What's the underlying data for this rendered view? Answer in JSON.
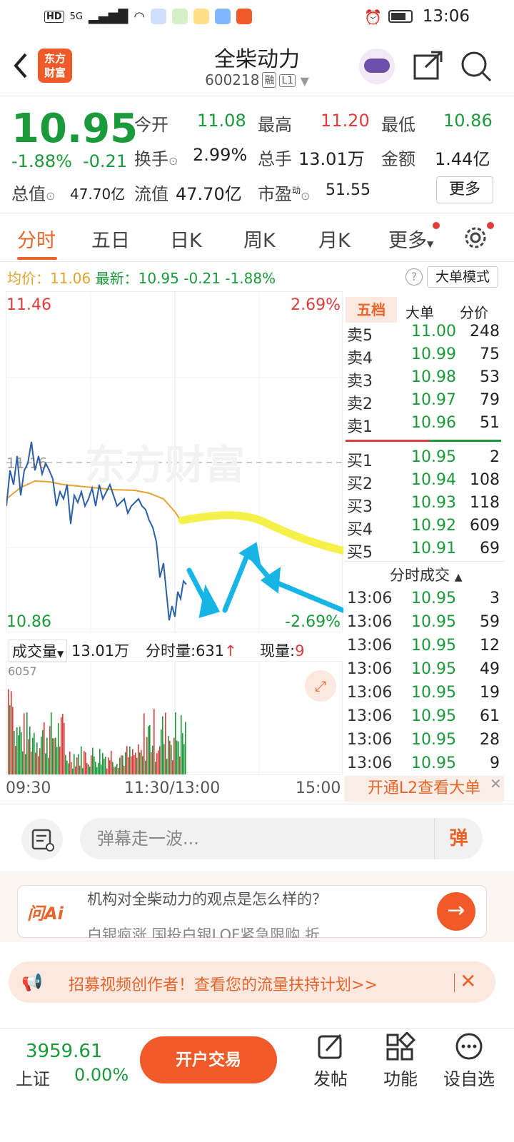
{
  "status": {
    "net": "HD",
    "net2": "5G",
    "time": "13:06"
  },
  "header": {
    "title": "全柴动力",
    "code": "600218",
    "tag1": "融",
    "tag2": "L1",
    "logo_line1": "东方",
    "logo_line2": "财富"
  },
  "quote": {
    "price": "10.95",
    "change_pct": "-1.88%",
    "change": "-0.21",
    "fields": [
      {
        "label": "今开",
        "value": "11.08"
      },
      {
        "label": "最高",
        "value": "11.20"
      },
      {
        "label": "最低",
        "value": "10.86"
      },
      {
        "label": "换手",
        "value": "2.99%"
      },
      {
        "label": "总手",
        "value": "13.01万"
      },
      {
        "label": "金额",
        "value": "1.44亿"
      },
      {
        "label": "总值",
        "value": "47.70亿"
      },
      {
        "label": "流值",
        "value": "47.70亿"
      },
      {
        "label": "市盈",
        "value": "51.55"
      }
    ],
    "pe_sup": "动",
    "more_btn": "更多"
  },
  "tabs": [
    "分时",
    "五日",
    "日K",
    "周K",
    "月K",
    "更多"
  ],
  "info_line": {
    "avg_label": "均价：",
    "avg": "11.06",
    "latest_label": "最新：",
    "latest": "10.95",
    "chg": "-0.21",
    "pct": "-1.88%",
    "mode_btn": "大单模式"
  },
  "chart": {
    "top_price": "11.46",
    "top_pct": "2.69%",
    "bottom_price": "10.86",
    "bottom_pct": "-2.69%",
    "mid_label": "11.16",
    "watermark": "东方财富",
    "colors": {
      "price_line": "#2b5fa8",
      "avg_line": "#e8a230",
      "highlight": "#f5f04a",
      "arrow": "#17b4e6"
    }
  },
  "order_book": {
    "tabs": [
      "五档",
      "大单",
      "分价"
    ],
    "asks": [
      {
        "label": "卖5",
        "price": "11.00",
        "vol": "248"
      },
      {
        "label": "卖4",
        "price": "10.99",
        "vol": "75"
      },
      {
        "label": "卖3",
        "price": "10.98",
        "vol": "53"
      },
      {
        "label": "卖2",
        "price": "10.97",
        "vol": "79"
      },
      {
        "label": "卖1",
        "price": "10.96",
        "vol": "51"
      }
    ],
    "bids": [
      {
        "label": "买1",
        "price": "10.95",
        "vol": "2"
      },
      {
        "label": "买2",
        "price": "10.94",
        "vol": "108"
      },
      {
        "label": "买3",
        "price": "10.93",
        "vol": "118"
      },
      {
        "label": "买4",
        "price": "10.92",
        "vol": "609"
      },
      {
        "label": "买5",
        "price": "10.91",
        "vol": "69"
      }
    ],
    "ticks_title": "分时成交",
    "ticks": [
      {
        "time": "13:06",
        "price": "10.95",
        "vol": "3"
      },
      {
        "time": "13:06",
        "price": "10.95",
        "vol": "59"
      },
      {
        "time": "13:06",
        "price": "10.95",
        "vol": "12"
      },
      {
        "time": "13:06",
        "price": "10.95",
        "vol": "49"
      },
      {
        "time": "13:06",
        "price": "10.95",
        "vol": "19"
      },
      {
        "time": "13:06",
        "price": "10.95",
        "vol": "61"
      },
      {
        "time": "13:06",
        "price": "10.95",
        "vol": "28"
      },
      {
        "time": "13:06",
        "price": "10.95",
        "vol": "9"
      }
    ],
    "l2_btn": "开通L2查看大单"
  },
  "volume": {
    "selector": "成交量",
    "total": "13.01万",
    "min_label": "分时量:631",
    "cur_label": "现量:",
    "cur": "9",
    "max": "6057"
  },
  "time_axis": [
    "09:30",
    "11:30/13:00",
    "15:00"
  ],
  "comment": {
    "placeholder": "弹幕走一波...",
    "send": "弹"
  },
  "ai": {
    "logo": "问Ai",
    "question": "机构对全柴动力的观点是怎么样的？",
    "question2": "白银疯涨 国投白银LOF紧急限购 折"
  },
  "banner": {
    "text": "招募视频创作者！查看您的流量扶持计划>>"
  },
  "bottom": {
    "index_value": "3959.61",
    "index_name": "上证",
    "index_pct": "0.00%",
    "trade_btn": "开户交易",
    "nav": [
      "发帖",
      "功能",
      "设自选"
    ]
  }
}
